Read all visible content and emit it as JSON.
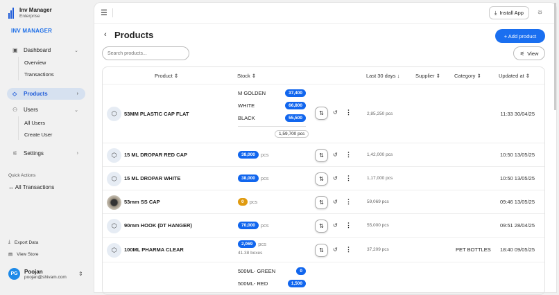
{
  "brand": {
    "title": "Inv Manager",
    "subtitle": "Enterprise",
    "section": "INV MANAGER"
  },
  "nav": {
    "dashboard": "Dashboard",
    "overview": "Overview",
    "transactions": "Transactions",
    "products": "Products",
    "users": "Users",
    "all_users": "All Users",
    "create_user": "Create User",
    "settings": "Settings"
  },
  "quick_actions": {
    "title": "Quick Actions",
    "all_transactions": "All Transactions"
  },
  "footer": {
    "export": "Export Data",
    "store": "View Store"
  },
  "user": {
    "initials": "PG",
    "name": "Poojan",
    "email": "poojan@shivam.com"
  },
  "topbar": {
    "install": "Install App"
  },
  "page": {
    "title": "Products",
    "add": "+ Add product",
    "search_placeholder": "Search products...",
    "view": "View"
  },
  "columns": {
    "product": "Product",
    "stock": "Stock",
    "last30": "Last 30 days",
    "supplier": "Supplier",
    "category": "Category",
    "updated": "Updated at"
  },
  "rows": [
    {
      "name": "53MM PLASTIC CAP FLAT",
      "variants": [
        {
          "name": "M GOLDEN",
          "qty": "37,400"
        },
        {
          "name": "WHITE",
          "qty": "66,800"
        },
        {
          "name": "BLACK",
          "qty": "55,500"
        }
      ],
      "total": "1,59,700 pcs",
      "last30": "2,85,250 pcs",
      "category": "",
      "updated": "11:33 30/04/25"
    },
    {
      "name": "15 ML DROPAR RED CAP",
      "qty": "38,000",
      "unit": "pcs",
      "last30": "1,42,000 pcs",
      "category": "",
      "updated": "10:50 13/05/25"
    },
    {
      "name": "15 ML DROPAR WHITE",
      "qty": "38,000",
      "unit": "pcs",
      "last30": "1,17,000 pcs",
      "category": "",
      "updated": "10:50 13/05/25"
    },
    {
      "name": "53mm SS CAP",
      "qty": "0",
      "unit": "pcs",
      "last30": "59,069 pcs",
      "category": "",
      "updated": "09:46 13/05/25"
    },
    {
      "name": "90mm HOOK (DT HANGER)",
      "qty": "70,000",
      "unit": "pcs",
      "last30": "55,000 pcs",
      "category": "",
      "updated": "09:51 28/04/25"
    },
    {
      "name": "100ML PHARMA CLEAR",
      "qty": "2,069",
      "unit": "pcs",
      "boxes": "41.38 boxes",
      "last30": "37,209 pcs",
      "category": "PET BOTTLES",
      "updated": "18:40 09/05/25"
    },
    {
      "variants": [
        {
          "name": "500ML- GREEN",
          "qty": "0"
        },
        {
          "name": "500ML- RED",
          "qty": "1,500"
        }
      ]
    }
  ]
}
